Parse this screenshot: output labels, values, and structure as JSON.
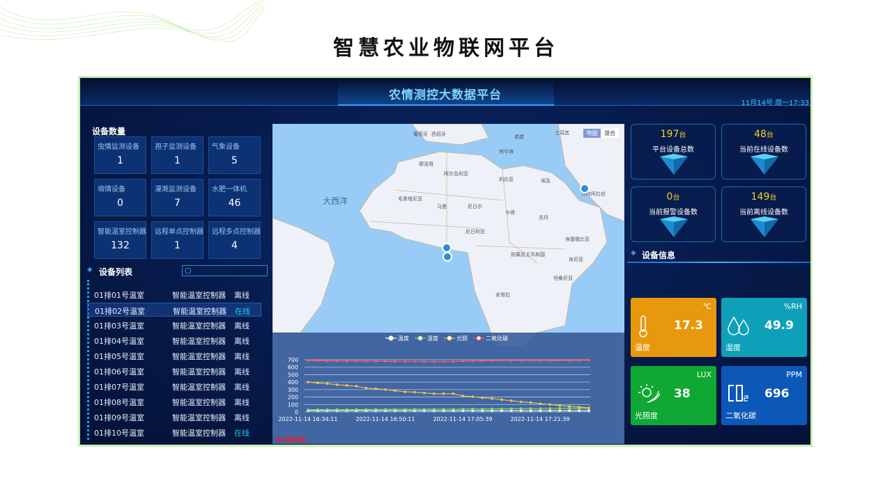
{
  "page_title": "智慧农业物联网平台",
  "dashboard": {
    "title": "农情测控大数据平台",
    "datetime": "11月14号 周一17:33"
  },
  "device_count": {
    "title": "设备数量",
    "tiles": [
      {
        "label": "虫情监测设备",
        "value": "1"
      },
      {
        "label": "孢子监测设备",
        "value": "1"
      },
      {
        "label": "气象设备",
        "value": "5"
      },
      {
        "label": "墒情设备",
        "value": "0"
      },
      {
        "label": "灌溉监测设备",
        "value": "7"
      },
      {
        "label": "水肥一体机",
        "value": "46"
      },
      {
        "label": "智能温室控制器",
        "value": "132"
      },
      {
        "label": "远程单点控制器",
        "value": "1"
      },
      {
        "label": "远程多点控制器",
        "value": "4"
      }
    ]
  },
  "device_list": {
    "title": "设备列表",
    "search_placeholder": "",
    "rows": [
      {
        "name": "01排01号温室",
        "type": "智能温室控制器",
        "status": "离线"
      },
      {
        "name": "01排02号温室",
        "type": "智能温室控制器",
        "status": "在线"
      },
      {
        "name": "01排03号温室",
        "type": "智能温室控制器",
        "status": "离线"
      },
      {
        "name": "01排04号温室",
        "type": "智能温室控制器",
        "status": "离线"
      },
      {
        "name": "01排05号温室",
        "type": "智能温室控制器",
        "status": "离线"
      },
      {
        "name": "01排06号温室",
        "type": "智能温室控制器",
        "status": "离线"
      },
      {
        "name": "01排07号温室",
        "type": "智能温室控制器",
        "status": "离线"
      },
      {
        "name": "01排08号温室",
        "type": "智能温室控制器",
        "status": "离线"
      },
      {
        "name": "01排09号温室",
        "type": "智能温室控制器",
        "status": "离线"
      },
      {
        "name": "01排10号温室",
        "type": "智能温室控制器",
        "status": "在线"
      }
    ]
  },
  "map": {
    "btn_map": "地图",
    "btn_hybrid": "混合",
    "labels": {
      "ocean": "大西洋",
      "algeria": "阿尔及利亚",
      "libya": "利比亚",
      "egypt": "埃及",
      "mali": "马里",
      "niger": "尼日尔",
      "chad": "乍得",
      "sudan": "苏丹",
      "nigeria": "尼日利亚",
      "ethiopia": "埃塞俄比亚",
      "drc": "刚果民主共和国",
      "angola": "安哥拉",
      "mauritania": "毛里塔尼亚",
      "morocco": "摩洛哥",
      "kenya": "肯尼亚",
      "tanzania": "坦桑尼亚",
      "saudi": "沙特阿拉伯",
      "mediterranean": "地中海",
      "turkey": "土耳其",
      "spain": "西班牙",
      "portugal": "葡萄牙",
      "greece": "希腊"
    },
    "logo": "Bai度地图"
  },
  "chart_data": {
    "type": "line",
    "title": "",
    "xlabel": "",
    "ylabel": "",
    "ylim": [
      0,
      700
    ],
    "yticks": [
      0,
      100,
      200,
      300,
      400,
      500,
      600,
      700
    ],
    "xtick_labels": [
      "2022-11-14 16:34:11",
      "2022-11-14 16:50:11",
      "2022-11-14 17:05:39",
      "2022-11-14 17:21:39"
    ],
    "legend_position": "top-center",
    "series": [
      {
        "name": "温度",
        "color": "#ffffff",
        "values": [
          17,
          17,
          17,
          17,
          17,
          17,
          17,
          17,
          17,
          17,
          17,
          17,
          17,
          17,
          17,
          17,
          17,
          17,
          17,
          17,
          17,
          17,
          17,
          17,
          17,
          17,
          17,
          17,
          17,
          17
        ]
      },
      {
        "name": "湿度",
        "color": "#8be04e",
        "values": [
          30,
          31,
          31,
          32,
          32,
          33,
          33,
          34,
          34,
          35,
          35,
          36,
          36,
          37,
          38,
          38,
          39,
          40,
          40,
          41,
          42,
          43,
          44,
          44,
          45,
          46,
          47,
          48,
          49,
          50
        ]
      },
      {
        "name": "光照",
        "color": "#f5c242",
        "values": [
          400,
          390,
          380,
          365,
          355,
          345,
          320,
          310,
          300,
          285,
          270,
          265,
          255,
          245,
          245,
          245,
          215,
          205,
          190,
          180,
          165,
          150,
          135,
          125,
          110,
          100,
          85,
          75,
          65,
          55
        ]
      },
      {
        "name": "二氧化碳",
        "color": "#ff5a5a",
        "values": [
          690,
          688,
          685,
          683,
          682,
          681,
          680,
          679,
          678,
          677,
          676,
          675,
          674,
          673,
          673,
          674,
          680,
          683,
          686,
          688,
          690,
          690,
          690,
          690,
          690,
          690,
          690,
          690,
          690,
          695
        ]
      }
    ]
  },
  "stats": [
    {
      "value": "197",
      "unit": "台",
      "label": "平台设备总数"
    },
    {
      "value": "48",
      "unit": "台",
      "label": "当前在线设备数"
    },
    {
      "value": "0",
      "unit": "台",
      "label": "当前报警设备数"
    },
    {
      "value": "149",
      "unit": "台",
      "label": "当前离线设备数"
    }
  ],
  "device_info": {
    "title": "设备信息",
    "cards": [
      {
        "label": "温度",
        "value": "17.3",
        "unit": "℃",
        "color": "#e8980c"
      },
      {
        "label": "湿度",
        "value": "49.9",
        "unit": "%RH",
        "color": "#0ea0b8"
      },
      {
        "label": "光照度",
        "value": "38",
        "unit": "LUX",
        "color": "#0fa832"
      },
      {
        "label": "二氧化碳",
        "value": "696",
        "unit": "PPM",
        "color": "#0b58b8"
      }
    ]
  }
}
